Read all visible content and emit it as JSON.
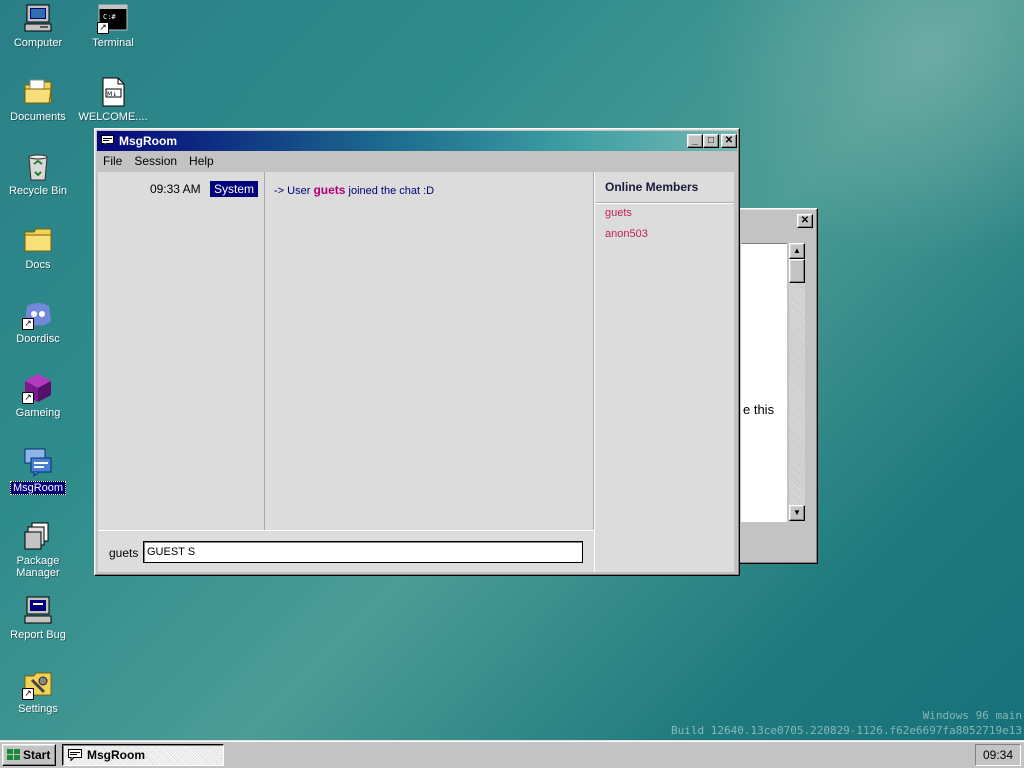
{
  "desktop": {
    "icons": [
      {
        "label": "Computer",
        "icon": "computer-icon"
      },
      {
        "label": "Terminal",
        "icon": "terminal-icon"
      },
      {
        "label": "Documents",
        "icon": "documents-folder-icon"
      },
      {
        "label": "WELCOME....",
        "icon": "markdown-file-icon"
      },
      {
        "label": "Recycle Bin",
        "icon": "recycle-bin-icon"
      },
      {
        "label": "Docs",
        "icon": "folder-icon"
      },
      {
        "label": "Doordisc",
        "icon": "doordisc-icon"
      },
      {
        "label": "Gameing",
        "icon": "game-cube-icon"
      },
      {
        "label": "MsgRoom",
        "icon": "msgroom-icon"
      },
      {
        "label": "Package Manager",
        "icon": "package-manager-icon"
      },
      {
        "label": "Report Bug",
        "icon": "report-bug-icon"
      },
      {
        "label": "Settings",
        "icon": "settings-icon"
      }
    ],
    "watermark": {
      "line1": "Windows 96 main",
      "line2": "Build 12640.13ce0705.220829-1126.f62e6697fa8052719e13"
    }
  },
  "background_window": {
    "close_glyph": "✕",
    "partial_text": "e this"
  },
  "window": {
    "title": "MsgRoom",
    "menu": [
      "File",
      "Session",
      "Help"
    ],
    "messages": [
      {
        "time": "09:33 AM",
        "sender": "System",
        "prefix": "-> User",
        "user": "guets",
        "suffix": "joined the chat :D"
      }
    ],
    "members_title": "Online Members",
    "members": [
      "guets",
      "anon503"
    ],
    "nickname": "guets",
    "input_value": "GUEST S"
  },
  "taskbar": {
    "start_label": "Start",
    "task_label": "MsgRoom",
    "clock": "09:34"
  },
  "colors": {
    "title_start": "#05057a",
    "title_end": "#74b8b3",
    "member_color": "#c0205a",
    "username_color": "#b20074",
    "system_badge": "#00007b"
  }
}
